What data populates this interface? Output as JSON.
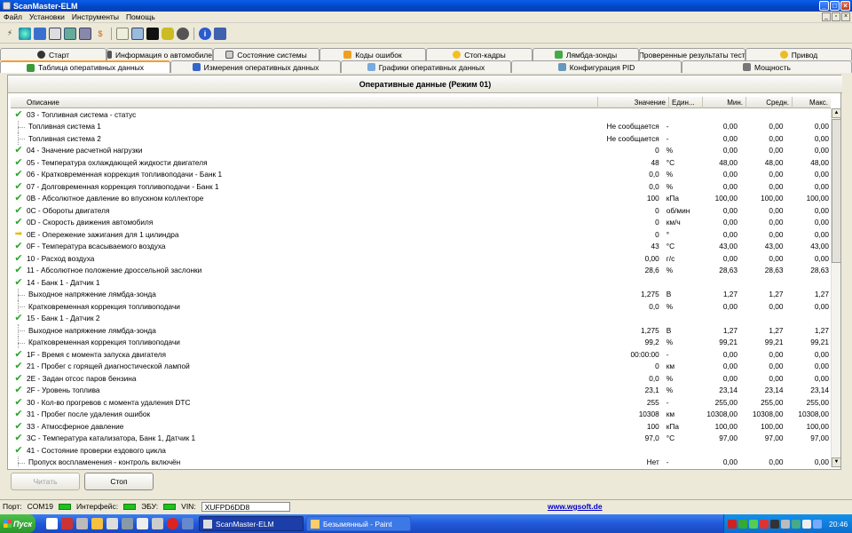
{
  "window": {
    "title": "ScanMaster-ELM"
  },
  "menu": [
    "Файл",
    "Установки",
    "Инструменты",
    "Помощь"
  ],
  "tabs_row1": [
    {
      "label": "Старт",
      "icon": "start-icon"
    },
    {
      "label": "Информация о автомобиле",
      "icon": "info-icon"
    },
    {
      "label": "Состояние системы",
      "icon": "status-icon"
    },
    {
      "label": "Коды ошибок",
      "icon": "warning-icon"
    },
    {
      "label": "Стоп-кадры",
      "icon": "freeze-frame-icon"
    },
    {
      "label": "Лямбда-зонды",
      "icon": "lambda-icon"
    },
    {
      "label": "Проверенные результаты теста",
      "icon": "test-results-icon"
    },
    {
      "label": "Привод",
      "icon": "drive-icon"
    }
  ],
  "tabs_row2": [
    {
      "label": "Таблица оперативных данных",
      "icon": "table-icon",
      "active": true
    },
    {
      "label": "Измерения оперативных данных",
      "icon": "gauge-icon"
    },
    {
      "label": "Графики оперативных данных",
      "icon": "chart-icon"
    },
    {
      "label": "Конфигурация PID",
      "icon": "config-icon"
    },
    {
      "label": "Мощность",
      "icon": "power-icon"
    }
  ],
  "panel": {
    "title": "Оперативные данные (Режим 01)"
  },
  "columns": {
    "desc": "Описание",
    "val": "Значение",
    "unit": "Един...",
    "min": "Мин.",
    "avg": "Средн.",
    "max": "Макс."
  },
  "rows": [
    {
      "ind": "check",
      "desc": "03 - Топливная система - статус",
      "val": "",
      "unit": "",
      "min": "",
      "avg": "",
      "max": ""
    },
    {
      "ind": "child",
      "desc": "Топливная система 1",
      "val": "Не сообщается",
      "unit": "-",
      "min": "0,00",
      "avg": "0,00",
      "max": "0,00"
    },
    {
      "ind": "child",
      "desc": "Топливная система 2",
      "val": "Не сообщается",
      "unit": "-",
      "min": "0,00",
      "avg": "0,00",
      "max": "0,00"
    },
    {
      "ind": "check",
      "desc": "04 - Значение расчетной нагрузки",
      "val": "0",
      "unit": "%",
      "min": "0,00",
      "avg": "0,00",
      "max": "0,00"
    },
    {
      "ind": "check",
      "desc": "05 - Температура охлаждающей жидкости двигателя",
      "val": "48",
      "unit": "°C",
      "min": "48,00",
      "avg": "48,00",
      "max": "48,00"
    },
    {
      "ind": "check",
      "desc": "06 - Кратковременная коррекция топливоподачи - Банк 1",
      "val": "0,0",
      "unit": "%",
      "min": "0,00",
      "avg": "0,00",
      "max": "0,00"
    },
    {
      "ind": "check",
      "desc": "07 - Долговременная коррекция топливоподачи - Банк 1",
      "val": "0,0",
      "unit": "%",
      "min": "0,00",
      "avg": "0,00",
      "max": "0,00"
    },
    {
      "ind": "check",
      "desc": "0B - Абсолютное давление во впускном коллекторе",
      "val": "100",
      "unit": "кПа",
      "min": "100,00",
      "avg": "100,00",
      "max": "100,00"
    },
    {
      "ind": "check",
      "desc": "0C - Обороты двигателя",
      "val": "0",
      "unit": "об/мин",
      "min": "0,00",
      "avg": "0,00",
      "max": "0,00"
    },
    {
      "ind": "check",
      "desc": "0D - Скорость движения автомобиля",
      "val": "0",
      "unit": "км/ч",
      "min": "0,00",
      "avg": "0,00",
      "max": "0,00"
    },
    {
      "ind": "arrow",
      "desc": "0E - Опережение зажигания для 1 цилиндра",
      "val": "0",
      "unit": "°",
      "min": "0,00",
      "avg": "0,00",
      "max": "0,00"
    },
    {
      "ind": "check",
      "desc": "0F - Температура всасываемого воздуха",
      "val": "43",
      "unit": "°C",
      "min": "43,00",
      "avg": "43,00",
      "max": "43,00"
    },
    {
      "ind": "check",
      "desc": "10 - Расход воздуха",
      "val": "0,00",
      "unit": "г/с",
      "min": "0,00",
      "avg": "0,00",
      "max": "0,00"
    },
    {
      "ind": "check",
      "desc": "11 - Абсолютное положение дроссельной заслонки",
      "val": "28,6",
      "unit": "%",
      "min": "28,63",
      "avg": "28,63",
      "max": "28,63"
    },
    {
      "ind": "check",
      "desc": "14 - Банк 1 - Датчик 1",
      "val": "",
      "unit": "",
      "min": "",
      "avg": "",
      "max": ""
    },
    {
      "ind": "child",
      "desc": "Выходное напряжение лямбда-зонда",
      "val": "1,275",
      "unit": "В",
      "min": "1,27",
      "avg": "1,27",
      "max": "1,27"
    },
    {
      "ind": "child",
      "desc": "Кратковременная коррекция топливоподачи",
      "val": "0,0",
      "unit": "%",
      "min": "0,00",
      "avg": "0,00",
      "max": "0,00"
    },
    {
      "ind": "check",
      "desc": "15 - Банк 1 - Датчик 2",
      "val": "",
      "unit": "",
      "min": "",
      "avg": "",
      "max": ""
    },
    {
      "ind": "child",
      "desc": "Выходное напряжение лямбда-зонда",
      "val": "1,275",
      "unit": "В",
      "min": "1,27",
      "avg": "1,27",
      "max": "1,27"
    },
    {
      "ind": "child",
      "desc": "Кратковременная коррекция топливоподачи",
      "val": "99,2",
      "unit": "%",
      "min": "99,21",
      "avg": "99,21",
      "max": "99,21"
    },
    {
      "ind": "check",
      "desc": "1F - Время с момента запуска двигателя",
      "val": "00:00:00",
      "unit": "-",
      "min": "0,00",
      "avg": "0,00",
      "max": "0,00"
    },
    {
      "ind": "check",
      "desc": "21 - Пробег с горящей диагностической лампой",
      "val": "0",
      "unit": "км",
      "min": "0,00",
      "avg": "0,00",
      "max": "0,00"
    },
    {
      "ind": "check",
      "desc": "2E - Задан отсос паров бензина",
      "val": "0,0",
      "unit": "%",
      "min": "0,00",
      "avg": "0,00",
      "max": "0,00"
    },
    {
      "ind": "check",
      "desc": "2F - Уровень топлива",
      "val": "23,1",
      "unit": "%",
      "min": "23,14",
      "avg": "23,14",
      "max": "23,14"
    },
    {
      "ind": "check",
      "desc": "30 - Кол-во прогревов с момента удаления DTC",
      "val": "255",
      "unit": "-",
      "min": "255,00",
      "avg": "255,00",
      "max": "255,00"
    },
    {
      "ind": "check",
      "desc": "31 - Пробег после удаления ошибок",
      "val": "10308",
      "unit": "км",
      "min": "10308,00",
      "avg": "10308,00",
      "max": "10308,00"
    },
    {
      "ind": "check",
      "desc": "33 - Атмосферное давление",
      "val": "100",
      "unit": "кПа",
      "min": "100,00",
      "avg": "100,00",
      "max": "100,00"
    },
    {
      "ind": "check",
      "desc": "3C - Температура катализатора, Банк 1, Датчик 1",
      "val": "97,0",
      "unit": "°C",
      "min": "97,00",
      "avg": "97,00",
      "max": "97,00"
    },
    {
      "ind": "check",
      "desc": "41 - Состояние проверки ездового цикла",
      "val": "",
      "unit": "",
      "min": "",
      "avg": "",
      "max": ""
    },
    {
      "ind": "child",
      "desc": "Пропуск воспламенения - контроль включён",
      "val": "Нет",
      "unit": "-",
      "min": "0,00",
      "avg": "0,00",
      "max": "0,00"
    }
  ],
  "buttons": {
    "read": "Читать",
    "stop": "Стоп"
  },
  "status": {
    "port_label": "Порт:",
    "port": "COM19",
    "interface_label": "Интерфейс:",
    "ecu_label": "ЭБУ:",
    "vin_label": "VIN:",
    "vin": "XUFPD6DD8",
    "website": "www.wgsoft.de"
  },
  "taskbar": {
    "start": "Пуск",
    "task1": "ScanMaster-ELM",
    "task2": "Безымянный - Paint",
    "clock": "20:46"
  },
  "colors": {
    "titlebar": "#0146c4",
    "check": "#2aa52a",
    "arrow": "#e8b800",
    "led": "#20c020",
    "website": "#0000cc"
  }
}
